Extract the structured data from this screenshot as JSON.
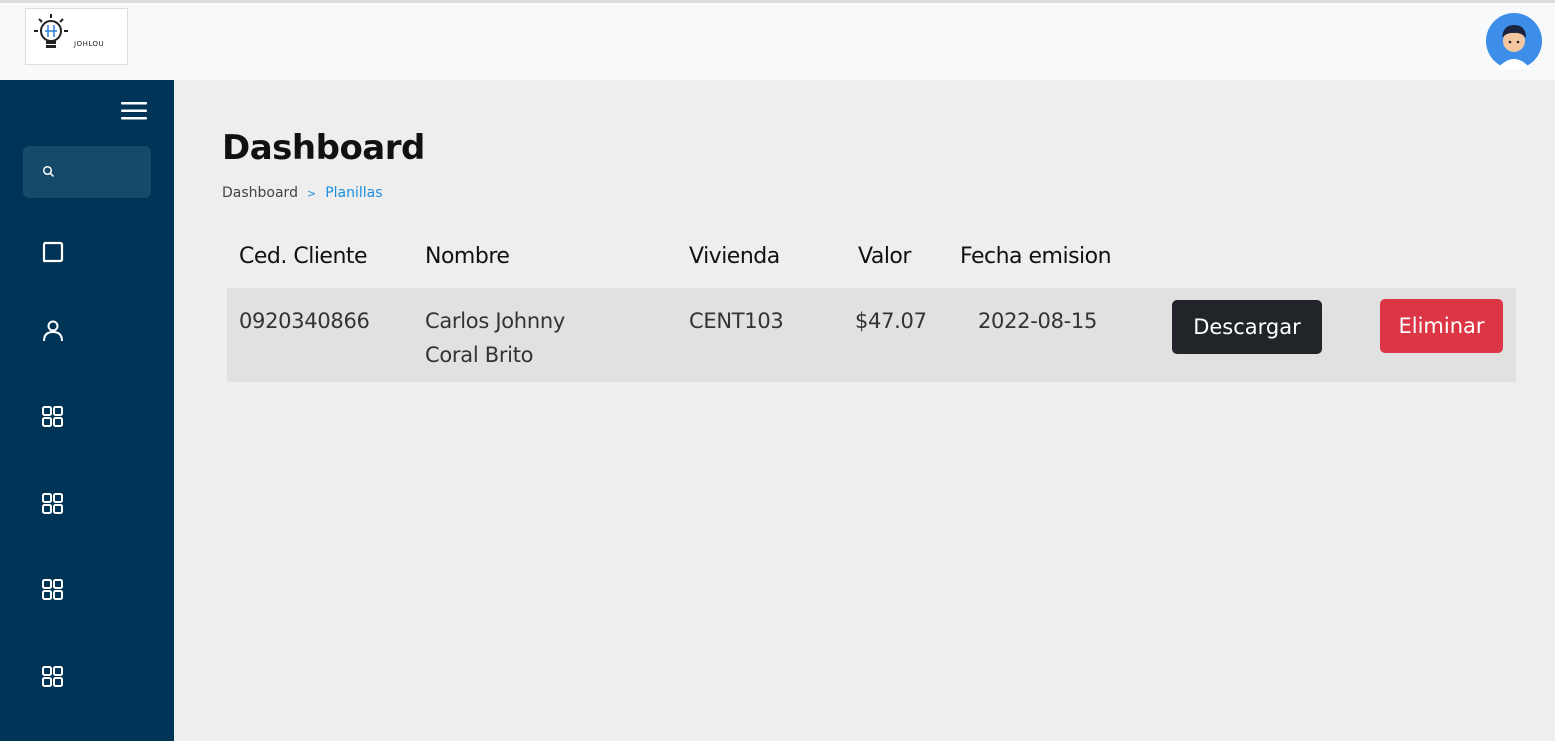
{
  "header": {
    "logo_text": "JOHLOU",
    "logo_icon": "lightbulb-icon",
    "avatar_icon": "user-avatar-icon",
    "avatar_bg": "#3d8ee8"
  },
  "sidebar": {
    "bg": "#003456",
    "menu_icon": "hamburger-icon",
    "search_placeholder": "",
    "items": [
      {
        "icon": "message-square-icon"
      },
      {
        "icon": "user-icon"
      },
      {
        "icon": "grid-icon"
      },
      {
        "icon": "grid-icon"
      },
      {
        "icon": "grid-icon"
      },
      {
        "icon": "grid-icon"
      }
    ]
  },
  "main": {
    "title": "Dashboard",
    "breadcrumb": {
      "home": "Dashboard",
      "separator": ">",
      "current": "Planillas"
    },
    "table": {
      "headers": [
        "Ced. Cliente",
        "Nombre",
        "Vivienda",
        "Valor",
        "Fecha emision"
      ],
      "rows": [
        {
          "ced": "0920340866",
          "nombre_line1": "Carlos Johnny",
          "nombre_line2": "Coral Brito",
          "vivienda": "CENT103",
          "valor": "$47.07",
          "fecha": "2022-08-15",
          "download_label": "Descargar",
          "delete_label": "Eliminar"
        }
      ]
    }
  },
  "colors": {
    "accent": "#1b8fe0",
    "dark_button": "#212529",
    "danger_button": "#dc3545"
  }
}
